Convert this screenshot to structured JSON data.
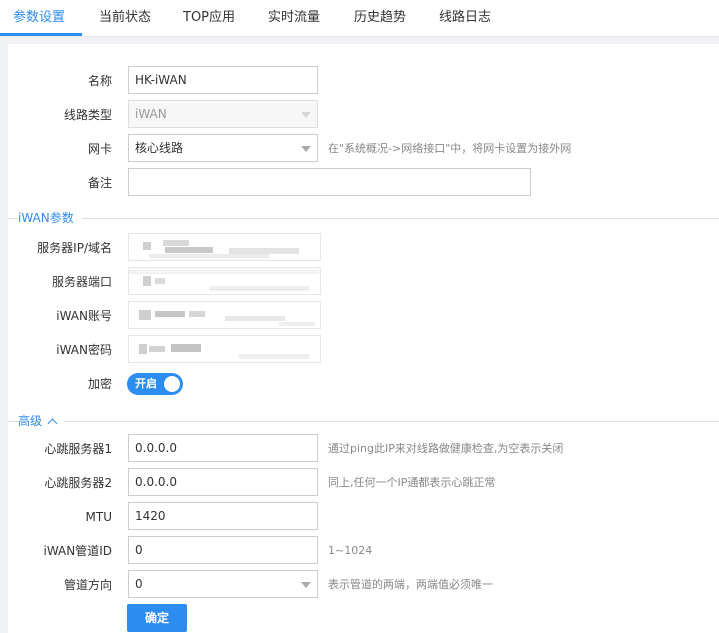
{
  "tabs": [
    "参数设置",
    "当前状态",
    "TOP应用",
    "实时流量",
    "历史趋势",
    "线路日志"
  ],
  "form": {
    "name_label": "名称",
    "name_value": "HK-iWAN",
    "line_type_label": "线路类型",
    "line_type_value": "iWAN",
    "nic_label": "网卡",
    "nic_value": "核心线路",
    "nic_hint": "在\"系统概况->网络接口\"中，将网卡设置为接外网",
    "remark_label": "备注",
    "remark_value": ""
  },
  "iwan": {
    "section_title": "iWAN参数",
    "server_label": "服务器IP/域名",
    "port_label": "服务器端口",
    "account_label": "iWAN账号",
    "password_label": "iWAN密码",
    "encrypt_label": "加密",
    "encrypt_toggle": "开启",
    "encrypt_on": true
  },
  "advanced": {
    "section_title": "高级",
    "hb1_label": "心跳服务器1",
    "hb1_value": "0.0.0.0",
    "hb1_hint": "通过ping此IP来对线路做健康检查,为空表示关闭",
    "hb2_label": "心跳服务器2",
    "hb2_value": "0.0.0.0",
    "hb2_hint": "同上,任何一个IP通都表示心跳正常",
    "mtu_label": "MTU",
    "mtu_value": "1420",
    "tunnel_label": "iWAN管道ID",
    "tunnel_value": "0",
    "tunnel_hint": "1~1024",
    "direction_label": "管道方向",
    "direction_value": "0",
    "direction_hint": "表示管道的两端，两端值必须唯一"
  },
  "submit_label": "确定",
  "colors": {
    "accent": "#2d8cf0",
    "page_bg": "#f0f2f5"
  }
}
